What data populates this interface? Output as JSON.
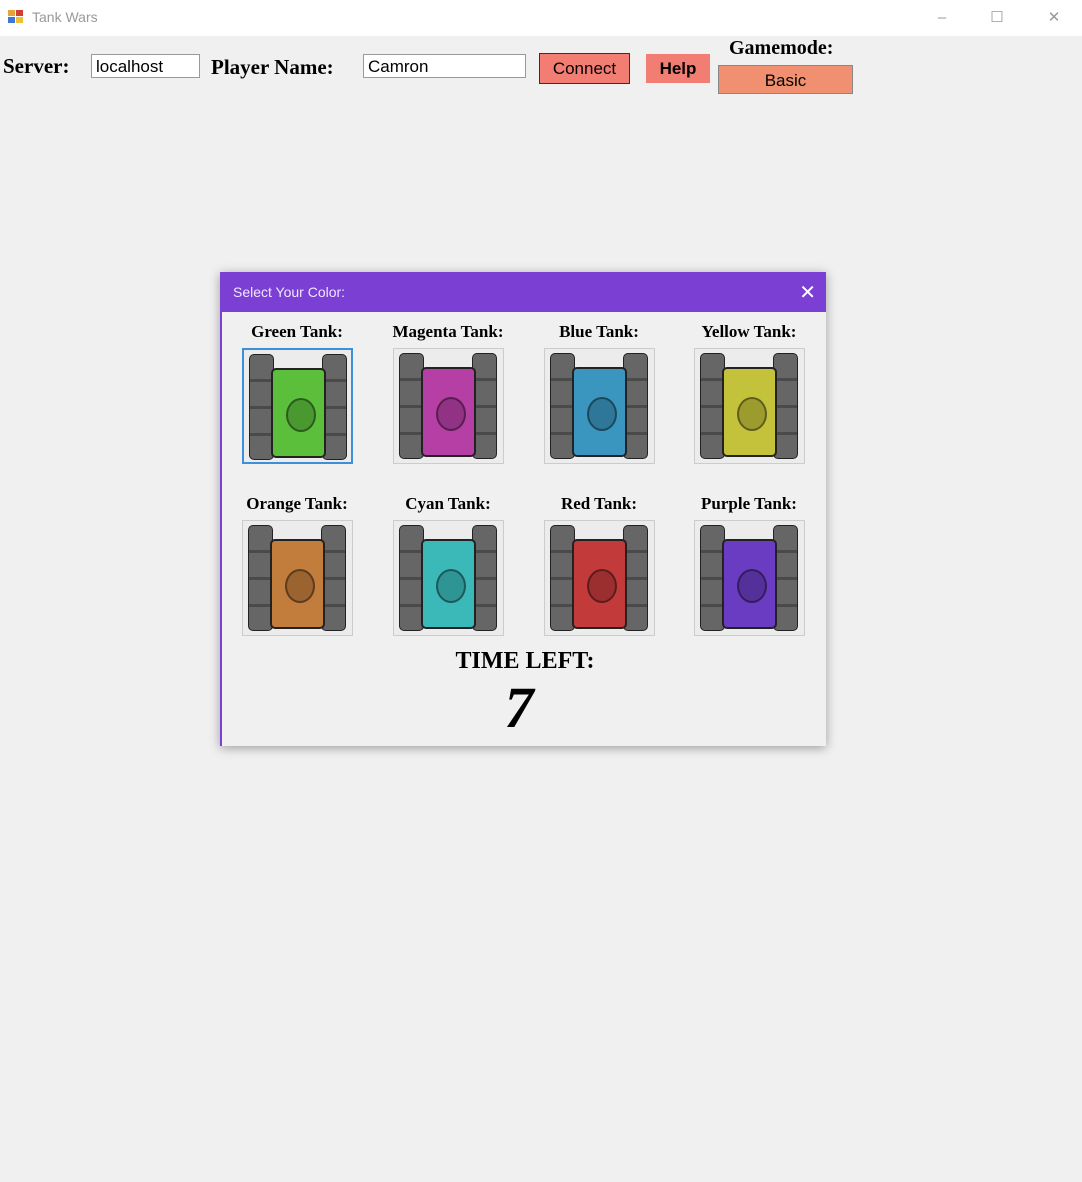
{
  "window": {
    "title": "Tank Wars"
  },
  "toolbar": {
    "server_label": "Server:",
    "server_value": "localhost",
    "player_label": "Player Name:",
    "player_value": "Camron",
    "connect_label": "Connect",
    "help_label": "Help",
    "gamemode_label": "Gamemode:",
    "gamemode_value": "Basic"
  },
  "dialog": {
    "title": "Select Your Color:",
    "time_label": "TIME LEFT:",
    "time_value": "7",
    "tanks": [
      {
        "label": "Green Tank:",
        "color": "#5cbf3c",
        "selected": true
      },
      {
        "label": "Magenta Tank:",
        "color": "#b63fa5",
        "selected": false
      },
      {
        "label": "Blue Tank:",
        "color": "#3a95bf",
        "selected": false
      },
      {
        "label": "Yellow Tank:",
        "color": "#c4c23a",
        "selected": false
      },
      {
        "label": "Orange Tank:",
        "color": "#c27c3c",
        "selected": false
      },
      {
        "label": "Cyan Tank:",
        "color": "#3bb9b9",
        "selected": false
      },
      {
        "label": "Red Tank:",
        "color": "#c23a3a",
        "selected": false
      },
      {
        "label": "Purple Tank:",
        "color": "#6a3cc2",
        "selected": false
      }
    ]
  }
}
